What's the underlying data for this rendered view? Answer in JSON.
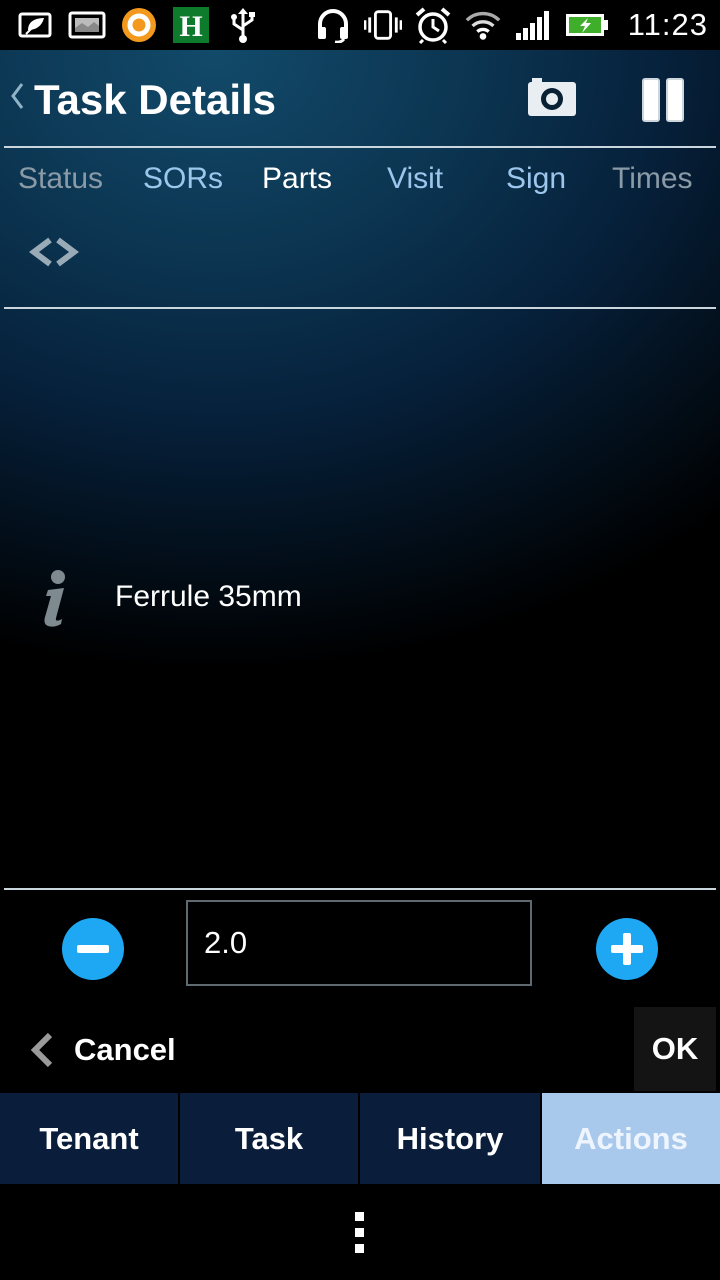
{
  "status_bar": {
    "time": "11:23",
    "left_icons": [
      "leaf-card-icon",
      "image-card-icon",
      "orange-app-icon",
      "h-app-icon",
      "usb-icon"
    ],
    "right_icons": [
      "headset-icon",
      "vibrate-icon",
      "alarm-icon",
      "wifi-icon",
      "signal-icon",
      "battery-charging-icon"
    ]
  },
  "header": {
    "title": "Task Details",
    "camera_icon": "camera-icon",
    "pause_icon": "pause-icon"
  },
  "tabs": [
    {
      "label": "Status",
      "color": "#8a9aa6"
    },
    {
      "label": "SORs",
      "color": "#9cc6ec"
    },
    {
      "label": "Parts",
      "color": "#ffffff"
    },
    {
      "label": "Visit",
      "color": "#9cc6ec"
    },
    {
      "label": "Sign",
      "color": "#9cc6ec"
    },
    {
      "label": "Times",
      "color": "#8a9aa6"
    }
  ],
  "part": {
    "name": "Ferrule 35mm",
    "icon": "info-icon"
  },
  "quantity": {
    "value": "2.0"
  },
  "actions": {
    "cancel_label": "Cancel",
    "ok_label": "OK"
  },
  "bottom_nav": [
    {
      "label": "Tenant",
      "active": false
    },
    {
      "label": "Task",
      "active": false
    },
    {
      "label": "History",
      "active": false
    },
    {
      "label": "Actions",
      "active": true
    }
  ],
  "colors": {
    "accent_blue": "#1ea7f2",
    "nav_bg": "#0a1d3a",
    "nav_active_bg": "#a8c8ec"
  }
}
